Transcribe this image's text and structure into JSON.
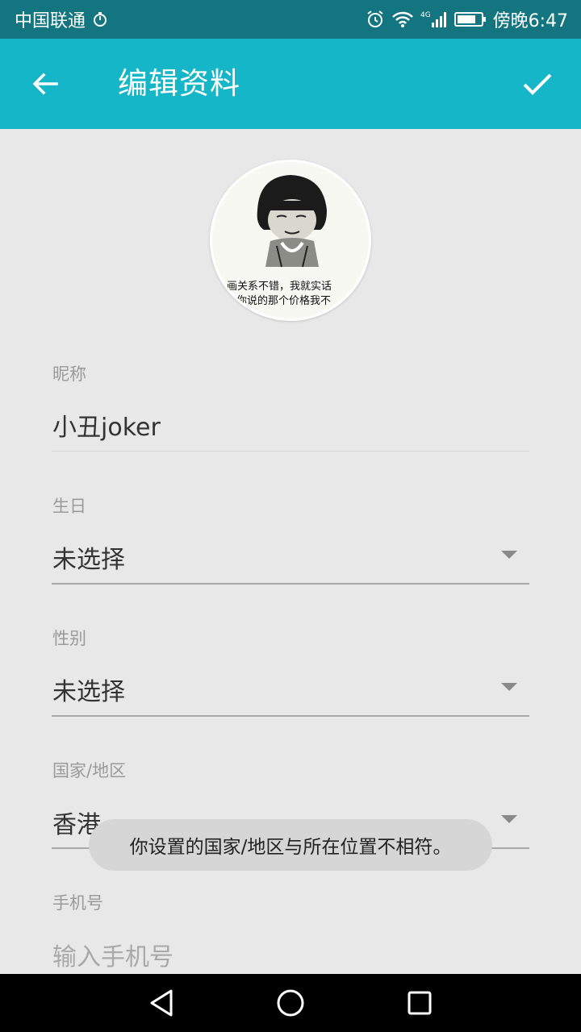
{
  "status_bar": {
    "carrier": "中国联通",
    "time": "傍晚6:47",
    "network_label": "4G"
  },
  "app_bar": {
    "title": "编辑资料"
  },
  "avatar": {
    "caption_line1": "画关系不错，我就实话",
    "caption_line2": "你说的那个价格我不"
  },
  "form": {
    "nickname": {
      "label": "昵称",
      "value": "小丑joker"
    },
    "birthday": {
      "label": "生日",
      "value": "未选择"
    },
    "gender": {
      "label": "性别",
      "value": "未选择"
    },
    "region": {
      "label": "国家/地区",
      "value": "香港"
    },
    "phone": {
      "label": "手机号",
      "placeholder": "输入手机号"
    }
  },
  "toast": {
    "message": "你设置的国家/地区与所在位置不相符。"
  },
  "colors": {
    "status_bar": "#127580",
    "app_bar": "#14b6c8",
    "background": "#e8e8e8",
    "nav_bar": "#000000"
  }
}
